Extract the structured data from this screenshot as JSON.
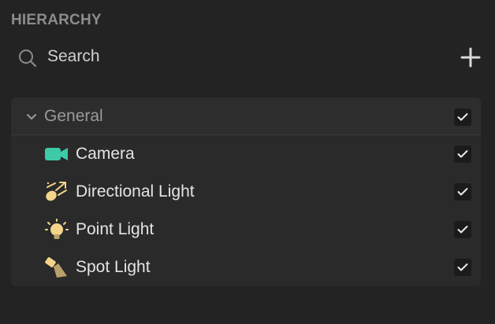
{
  "panel": {
    "title": "HIERARCHY"
  },
  "search": {
    "placeholder": "Search",
    "value": ""
  },
  "tree": {
    "group": {
      "label": "General",
      "expanded": true,
      "checked": true
    },
    "items": [
      {
        "label": "Camera",
        "icon": "camera-icon",
        "checked": true
      },
      {
        "label": "Directional Light",
        "icon": "directional-light-icon",
        "checked": true
      },
      {
        "label": "Point Light",
        "icon": "point-light-icon",
        "checked": true
      },
      {
        "label": "Spot Light",
        "icon": "spot-light-icon",
        "checked": true
      }
    ]
  },
  "colors": {
    "background": "#232323",
    "tree_background": "#2a2a2a",
    "camera_accent": "#3ec9a7",
    "light_accent": "#f3d58a",
    "muted_text": "#8c8c8c"
  }
}
